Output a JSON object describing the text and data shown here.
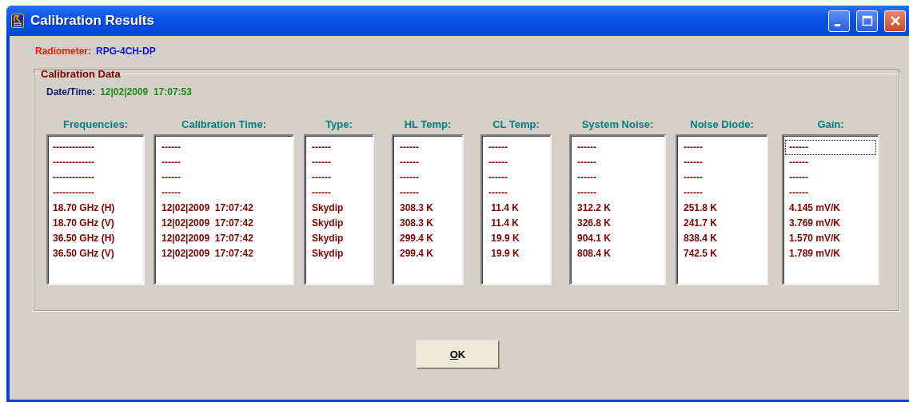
{
  "window": {
    "title": "Calibration Results"
  },
  "radiometer": {
    "label": "Radiometer:",
    "value": "RPG-4CH-DP"
  },
  "group": {
    "title": "Calibration Data",
    "datetime": {
      "label": "Date/Time:",
      "value": "12|02|2009  17:07:53"
    },
    "columns": [
      {
        "header": "Frequencies:",
        "focused": false,
        "items": [
          "-------------",
          "-------------",
          "-------------",
          "-------------",
          "18.70 GHz (H)",
          "18.70 GHz (V)",
          "36.50 GHz (H)",
          "36.50 GHz (V)"
        ]
      },
      {
        "header": "Calibration Time:",
        "focused": false,
        "items": [
          "------",
          "------",
          "------",
          "------",
          "12|02|2009  17:07:42",
          "12|02|2009  17:07:42",
          "12|02|2009  17:07:42",
          "12|02|2009  17:07:42"
        ]
      },
      {
        "header": "Type:",
        "focused": false,
        "items": [
          "------",
          "------",
          "------",
          "------",
          "Skydip",
          "Skydip",
          "Skydip",
          "Skydip"
        ]
      },
      {
        "header": "HL Temp:",
        "focused": false,
        "items": [
          "------",
          "------",
          "------",
          "------",
          "308.3 K",
          "308.3 K",
          "299.4 K",
          "299.4 K"
        ]
      },
      {
        "header": "CL Temp:",
        "focused": false,
        "items": [
          "------",
          "------",
          "------",
          "------",
          " 11.4 K",
          " 11.4 K",
          " 19.9 K",
          " 19.9 K"
        ]
      },
      {
        "header": "System Noise:",
        "focused": false,
        "items": [
          "------",
          "------",
          "------",
          "------",
          "312.2 K",
          "326.8 K",
          "904.1 K",
          "808.4 K"
        ]
      },
      {
        "header": "Noise Diode:",
        "focused": false,
        "items": [
          "------",
          "------",
          "------",
          "------",
          "251.8 K",
          "241.7 K",
          "838.4 K",
          "742.5 K"
        ]
      },
      {
        "header": "Gain:",
        "focused": true,
        "items": [
          "------",
          "------",
          "------",
          "------",
          "4.145 mV/K",
          "3.769 mV/K",
          "1.570 mV/K",
          "1.789 mV/K"
        ]
      }
    ]
  },
  "ok_button": {
    "label": "OK",
    "access_key_underlined": true
  }
}
